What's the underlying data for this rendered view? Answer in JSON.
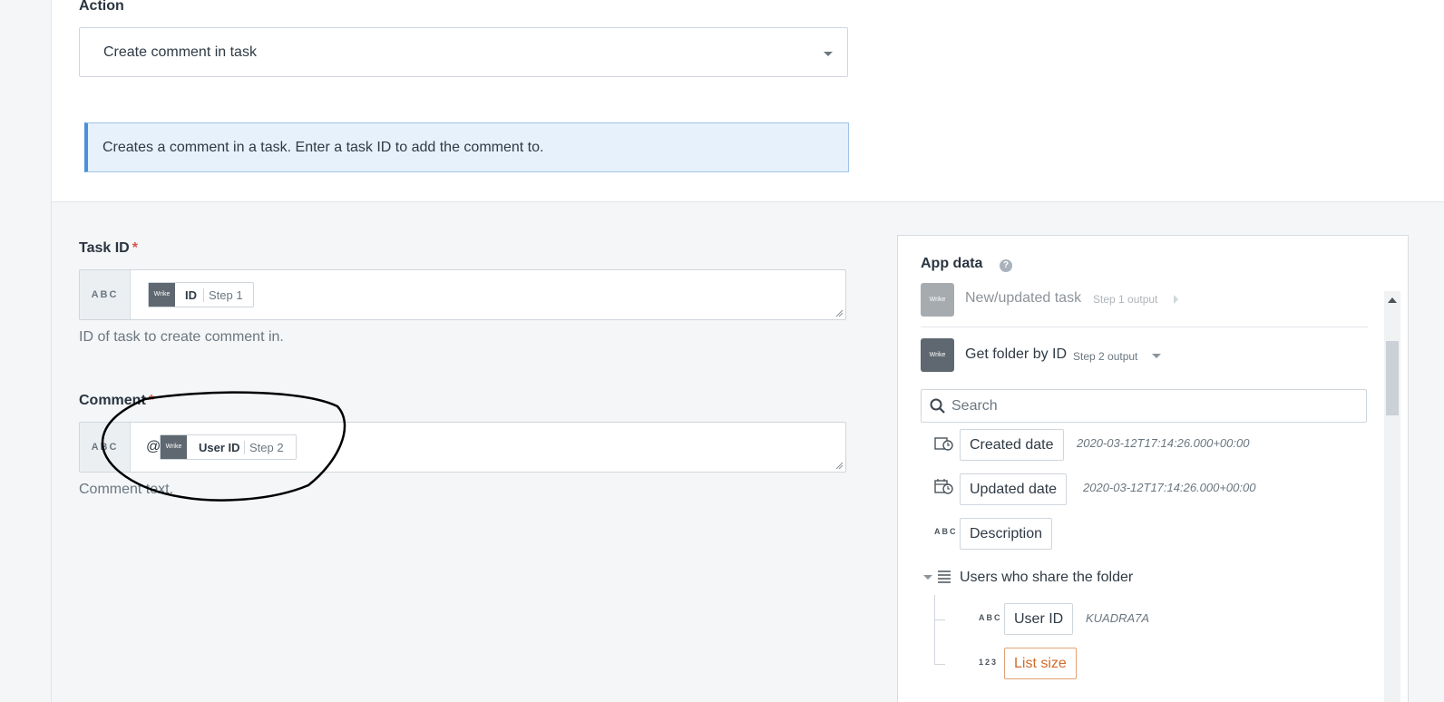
{
  "action": {
    "label": "Action",
    "selected": "Create comment in task",
    "info": "Creates a comment in a task. Enter a task ID to add the comment to."
  },
  "task_id": {
    "label": "Task ID",
    "required_mark": "*",
    "type_label": "ABC",
    "pill": {
      "logo": "Wrike",
      "name": "ID",
      "step": "Step 1"
    },
    "hint": "ID of task to create comment in."
  },
  "comment": {
    "label": "Comment",
    "required_mark": "*",
    "type_label": "ABC",
    "prefix": "@",
    "pill": {
      "logo": "Wrike",
      "name": "User ID",
      "step": "Step 2"
    },
    "hint": "Comment text."
  },
  "app_data": {
    "title": "App data",
    "help": "?",
    "steps": [
      {
        "logo": "Wrike",
        "title": "New/updated task",
        "output": "Step 1 output"
      },
      {
        "logo": "Wrike",
        "title": "Get folder by ID",
        "output": "Step 2 output"
      }
    ],
    "search_placeholder": "Search",
    "fields": [
      {
        "icon": "calendar-clock-icon",
        "label": "Created date",
        "sample": "2020-03-12T17:14:26.000+00:00"
      },
      {
        "icon": "calendar-clock-icon",
        "label": "Updated date",
        "sample": "2020-03-12T17:14:26.000+00:00"
      },
      {
        "icon": "text-type-icon",
        "type": "ABC",
        "label": "Description"
      }
    ],
    "list": {
      "label": "Users who share the folder",
      "children": [
        {
          "type": "ABC",
          "label": "User ID",
          "sample": "KUADRA7A"
        },
        {
          "type": "123",
          "label": "List size"
        }
      ]
    }
  },
  "colors": {
    "accent_blue": "#4a90d9",
    "info_bg": "#e6f1fb",
    "required_red": "#d9534f",
    "list_size_orange": "#d26a28"
  }
}
